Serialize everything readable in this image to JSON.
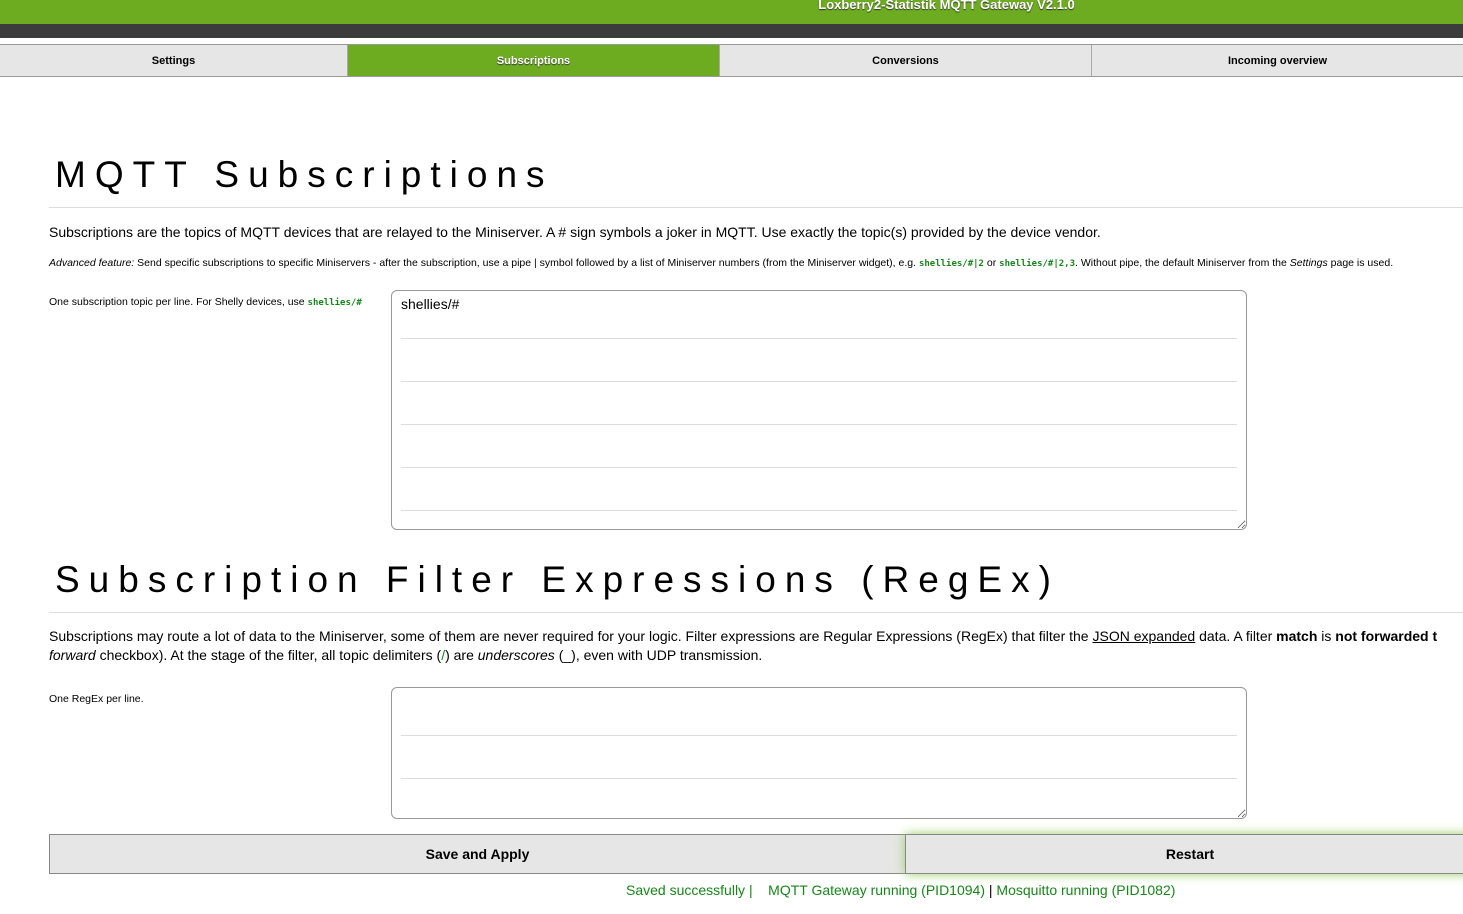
{
  "header": {
    "title": "Loxberry2-Statistik MQTT Gateway V2.1.0"
  },
  "tabs": [
    {
      "label": "Settings"
    },
    {
      "label": "Subscriptions",
      "active": true
    },
    {
      "label": "Conversions"
    },
    {
      "label": "Incoming overview"
    }
  ],
  "subs": {
    "title": "MQTT Subscriptions",
    "intro": "Subscriptions are the topics of MQTT devices that are relayed to the Miniserver. A # sign symbols a joker in MQTT. Use exactly the topic(s) provided by the device vendor.",
    "adv_em": "Advanced feature:",
    "adv_text1": " Send specific subscriptions to specific Miniservers - after the subscription, use a pipe | symbol followed by a list of Miniserver numbers (from the Miniserver widget), e.g. ",
    "adv_code1": "shellies/#|2",
    "adv_or": " or ",
    "adv_code2": "shellies/#|2,3",
    "adv_text2": ". Without pipe, the default Miniserver from the ",
    "adv_em2": "Settings",
    "adv_text3": " page is used.",
    "label": "One subscription topic per line. For Shelly devices, use ",
    "label_code": "shellies/#",
    "value": "shellies/#"
  },
  "filter": {
    "title": "Subscription Filter Expressions (RegEx)",
    "p1a": "Subscriptions may route a lot of data to the Miniserver, some of them are never required for your logic. Filter expressions are Regular Expressions (RegEx) that filter the ",
    "p1link": "JSON expanded",
    "p1b": " data. A filter ",
    "p1bold1": "match",
    "p1c": " is ",
    "p1bold2": "not forwarded t",
    "p2em": "forward",
    "p2a": " checkbox). At the stage of the filter, all topic delimiters (",
    "p2code": "/",
    "p2b": ") are ",
    "p2em2": "underscores",
    "p2c": " (_), even with UDP transmission.",
    "label": "One RegEx per line.",
    "value": ""
  },
  "buttons": {
    "save": "Save and Apply",
    "restart": "Restart"
  },
  "status": {
    "saved": "Saved successfully |",
    "gateway": "MQTT Gateway running (PID1094)",
    "sep": " | ",
    "mosquitto": "Mosquitto running (PID1082)"
  },
  "colors": {
    "accent": "#6dab21",
    "dark_bar": "#3c3c3c",
    "status_green": "#18851a"
  }
}
